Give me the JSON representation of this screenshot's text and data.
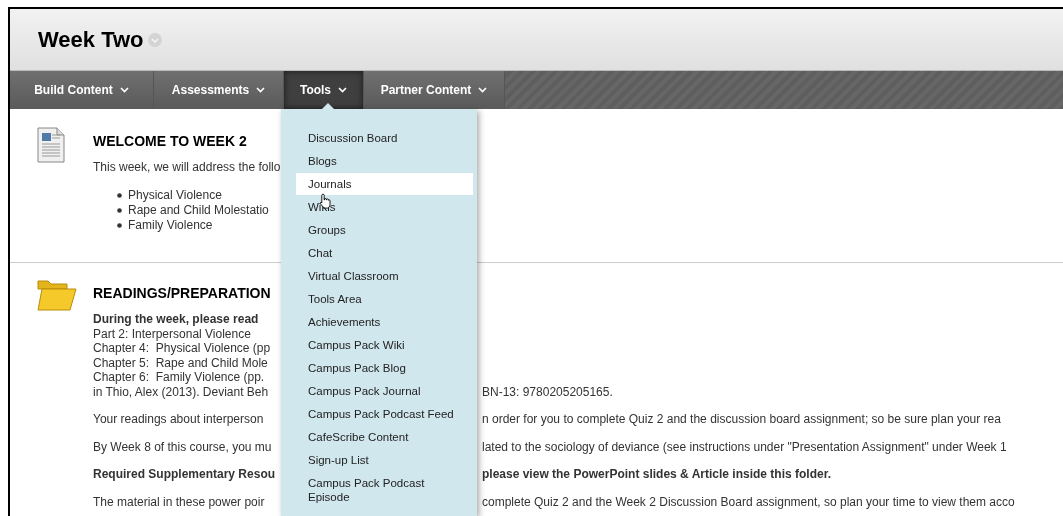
{
  "page": {
    "title": "Week Two"
  },
  "nav": [
    {
      "label": "Build Content",
      "selected": false
    },
    {
      "label": "Assessments",
      "selected": false
    },
    {
      "label": "Tools",
      "selected": true
    },
    {
      "label": "Partner Content",
      "selected": false
    }
  ],
  "tools_menu": {
    "items": [
      {
        "label": "Discussion Board",
        "selected": false
      },
      {
        "label": "Blogs",
        "selected": false
      },
      {
        "label": "Journals",
        "selected": true
      },
      {
        "label": "Wikis",
        "selected": false
      },
      {
        "label": "Groups",
        "selected": false
      },
      {
        "label": "Chat",
        "selected": false
      },
      {
        "label": "Virtual Classroom",
        "selected": false
      },
      {
        "label": "Tools Area",
        "selected": false
      },
      {
        "label": "Achievements",
        "selected": false
      },
      {
        "label": "Campus Pack Wiki",
        "selected": false
      },
      {
        "label": "Campus Pack Blog",
        "selected": false
      },
      {
        "label": "Campus Pack Journal",
        "selected": false
      },
      {
        "label": "Campus Pack Podcast Feed",
        "selected": false
      },
      {
        "label": "CafeScribe Content",
        "selected": false
      },
      {
        "label": "Sign-up List",
        "selected": false
      },
      {
        "label": "Campus Pack Podcast Episode",
        "selected": false
      }
    ]
  },
  "content": [
    {
      "kind": "document",
      "title": "WELCOME TO WEEK 2",
      "blocks": [
        {
          "kind": "lines",
          "lines": [
            {
              "left": "This week, we will address the follo",
              "bold": false
            }
          ]
        },
        {
          "kind": "bullets",
          "items": [
            "Physical Violence",
            "Rape and Child Molestatio",
            "Family Violence"
          ]
        }
      ]
    },
    {
      "kind": "folder",
      "title": "READINGS/PREPARATION",
      "blocks": [
        {
          "kind": "lines",
          "lines": [
            {
              "left": "During the week, please read",
              "bold": true
            },
            {
              "left": "Part 2: Interpersonal Violence",
              "bold": false
            },
            {
              "left": "Chapter 4:  Physical Violence (pp",
              "bold": false
            },
            {
              "left": "Chapter 5:  Rape and Child Mole",
              "bold": false
            },
            {
              "left": "Chapter 6:  Family Violence (pp.",
              "bold": false
            },
            {
              "left": "in Thio, Alex (2013). Deviant Beh",
              "right": "BN-13: 9780205205165.",
              "bold": false
            }
          ]
        },
        {
          "kind": "lines",
          "lines": [
            {
              "left": "Your readings about interperson",
              "right": "n order for you to complete Quiz 2 and the discussion board assignment; so be sure plan your rea",
              "bold": false
            }
          ]
        },
        {
          "kind": "lines",
          "lines": [
            {
              "left": "By Week 8 of this course, you mu",
              "right": "lated to the sociology of deviance (see instructions under \"Presentation Assignment\" under Week 1",
              "bold": false
            }
          ]
        },
        {
          "kind": "lines",
          "lines": [
            {
              "left": "Required Supplementary Resou",
              "right": "please view the PowerPoint slides & Article inside this folder.",
              "bold": true
            }
          ]
        },
        {
          "kind": "lines",
          "lines": [
            {
              "left": "The material in these power poir",
              "right": "complete Quiz 2 and the Week 2 Discussion Board assignment, so plan your time to view them acco",
              "bold": false
            }
          ]
        }
      ]
    }
  ]
}
